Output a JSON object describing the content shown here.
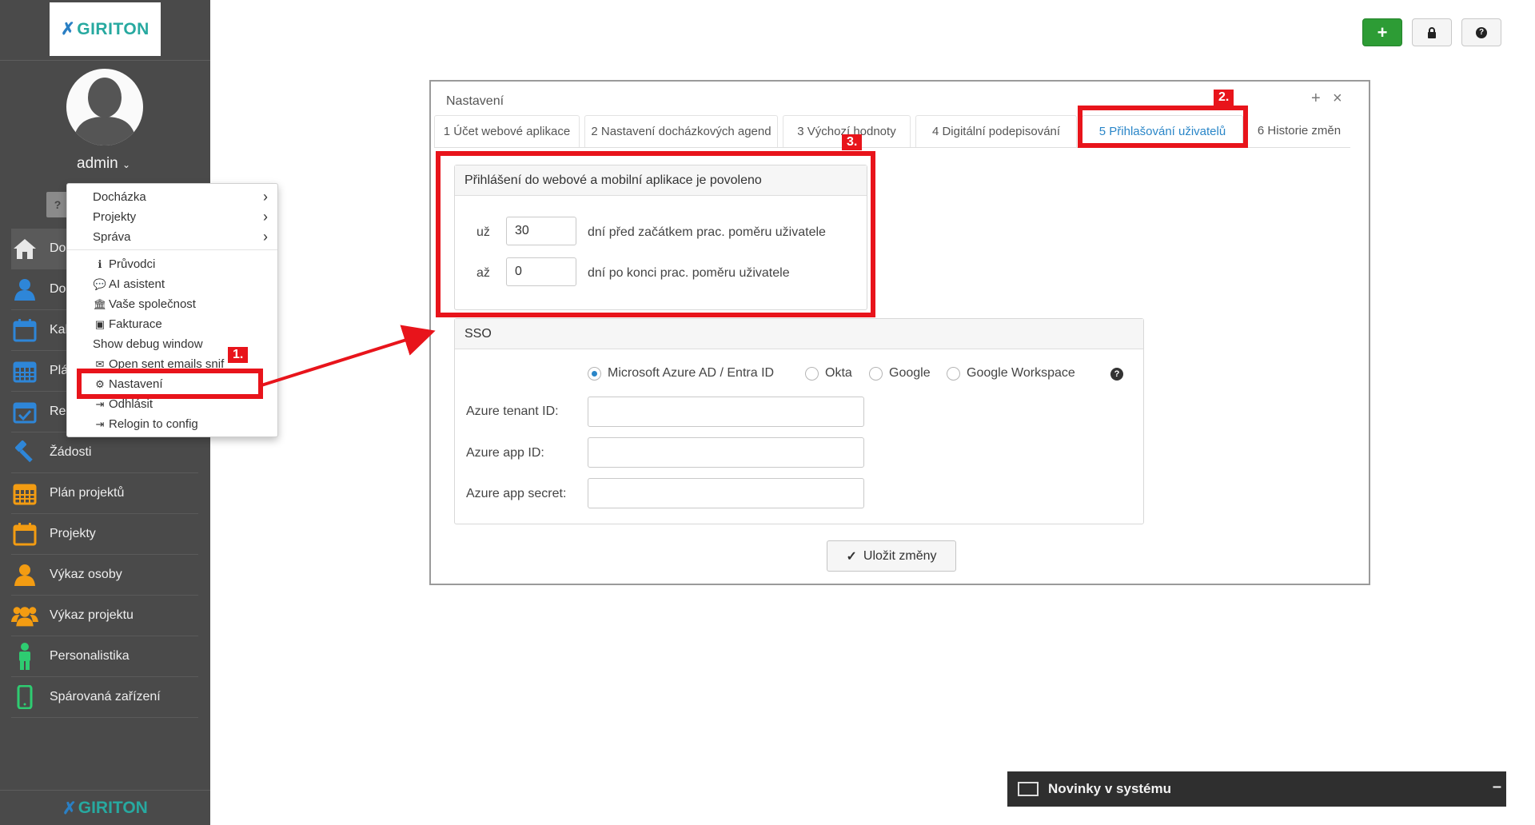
{
  "sidebar": {
    "logo": "GIRITON",
    "username": "admin",
    "help_chip": "?",
    "nav": [
      {
        "label": "Do",
        "icon": "home-icon"
      },
      {
        "label": "Do",
        "icon": "user-icon"
      },
      {
        "label": "Kal",
        "icon": "calendar-icon"
      },
      {
        "label": "Plá",
        "icon": "calendar-grid-icon"
      },
      {
        "label": "Reg",
        "icon": "calendar-check-icon"
      },
      {
        "label": "Žádosti",
        "icon": "gavel-icon"
      },
      {
        "label": "Plán projektů",
        "icon": "calendar-grid-icon"
      },
      {
        "label": "Projekty",
        "icon": "calendar-icon"
      },
      {
        "label": "Výkaz osoby",
        "icon": "user-icon"
      },
      {
        "label": "Výkaz projektu",
        "icon": "users-icon"
      },
      {
        "label": "Personalistika",
        "icon": "person-icon"
      },
      {
        "label": "Spárovaná zařízení",
        "icon": "mobile-icon"
      }
    ],
    "bottom_logo": "GIRITON"
  },
  "menu": {
    "items": [
      {
        "label": "Docházka",
        "icon": "",
        "submenu": true
      },
      {
        "label": "Projekty",
        "icon": "",
        "submenu": true
      },
      {
        "label": "Správa",
        "icon": "",
        "submenu": true
      },
      {
        "label": "Průvodci",
        "icon": "info-icon"
      },
      {
        "label": "AI asistent",
        "icon": "chat-icon"
      },
      {
        "label": "Vaše společnost",
        "icon": "bank-icon"
      },
      {
        "label": "Fakturace",
        "icon": "money-icon"
      },
      {
        "label": "Show debug window",
        "icon": ""
      },
      {
        "label": "Open sent emails snif",
        "icon": "envelope-icon"
      },
      {
        "label": "Nastavení",
        "icon": "gear-icon"
      },
      {
        "label": "Odhlásit",
        "icon": "sign-out-icon"
      },
      {
        "label": "Relogin to config",
        "icon": "sign-out-icon"
      }
    ]
  },
  "dialog": {
    "title": "Nastavení",
    "plus": "+",
    "close": "×",
    "tabs": [
      "1 Účet webové aplikace",
      "2 Nastavení docházkových agend",
      "3 Výchozí hodnoty",
      "4 Digitální podepisování",
      "5 Přihlašování uživatelů",
      "6 Historie změn"
    ],
    "active_tab": 4,
    "login_panel": {
      "title": "Přihlášení do webové a mobilní aplikace je povoleno",
      "row1": {
        "prefix": "už",
        "value": "30",
        "suffix": "dní před začátkem prac. poměru uživatele"
      },
      "row2": {
        "prefix": "až",
        "value": "0",
        "suffix": "dní po konci prac. poměru uživatele"
      }
    },
    "sso_panel": {
      "title": "SSO",
      "providers": [
        "Microsoft Azure AD / Entra ID",
        "Okta",
        "Google",
        "Google Workspace"
      ],
      "selected_provider": "Microsoft Azure AD / Entra ID",
      "help": "?",
      "fields": [
        {
          "label": "Azure tenant ID:",
          "value": ""
        },
        {
          "label": "Azure app ID:",
          "value": ""
        },
        {
          "label": "Azure app secret:",
          "value": ""
        }
      ]
    },
    "save_label": "Uložit změny"
  },
  "annotations": {
    "badge1": "1.",
    "badge2": "2.",
    "badge3": "3.",
    "color": "#e8141b"
  },
  "news": {
    "label": "Novinky v systému",
    "minimize": "–"
  },
  "colors": {
    "accent": "#2a86c8",
    "sidebar_bg": "#4a4a4a",
    "brand": "#27a9a0",
    "add_button": "#2d9c35"
  }
}
